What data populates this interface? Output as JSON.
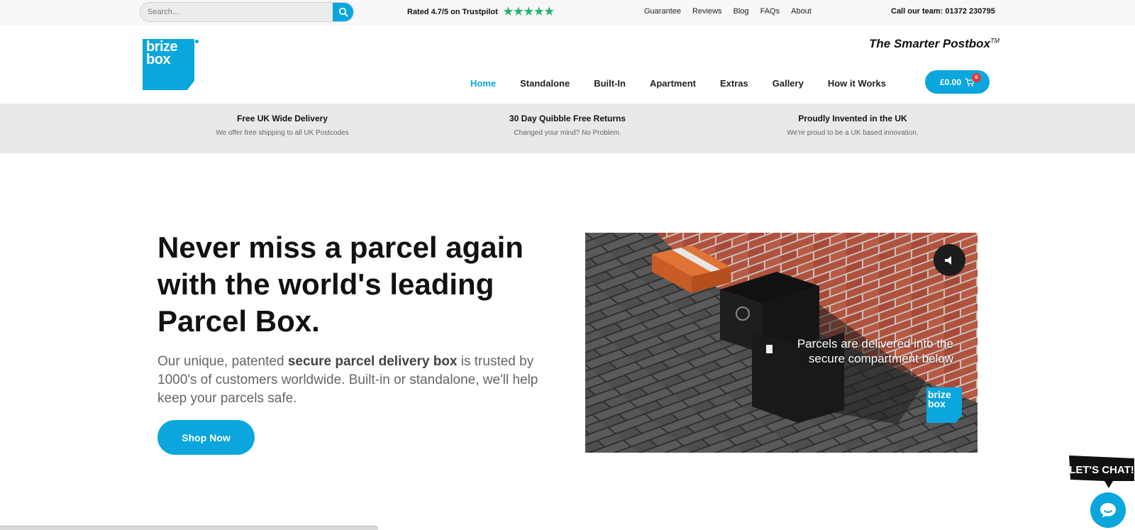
{
  "topbar": {
    "search_placeholder": "Search...",
    "trustpilot_text": "Rated 4.7/5 on Trustpilot",
    "trustpilot_rating": 4.7,
    "links": [
      "Guarantee",
      "Reviews",
      "Blog",
      "FAQs",
      "About"
    ],
    "call_text": "Call our team: 01372 230795"
  },
  "header": {
    "logo_line1": "brize",
    "logo_line2": "box",
    "tagline": "The Smarter Postbox",
    "tagline_mark": "TM",
    "nav": [
      {
        "label": "Home",
        "active": true
      },
      {
        "label": "Standalone",
        "active": false
      },
      {
        "label": "Built-In",
        "active": false
      },
      {
        "label": "Apartment",
        "active": false
      },
      {
        "label": "Extras",
        "active": false
      },
      {
        "label": "Gallery",
        "active": false
      },
      {
        "label": "How it Works",
        "active": false
      }
    ],
    "cart_total": "£0.00",
    "cart_count": "0"
  },
  "benefits": [
    {
      "title": "Free UK Wide Delivery",
      "subtitle": "We offer free shipping to all UK Postcodes"
    },
    {
      "title": "30 Day Quibble Free Returns",
      "subtitle": "Changed your mind? No Problem."
    },
    {
      "title": "Proudly Invented in the UK",
      "subtitle": "We're proud to be a UK based innovation."
    }
  ],
  "hero": {
    "title": "Never miss a parcel again with the world's leading Parcel Box.",
    "sub_before": "Our unique, patented ",
    "sub_bold": "secure parcel delivery box",
    "sub_after": " is trusted by 1000's of customers worldwide. Built-in or standalone, we'll help keep your parcels safe.",
    "cta": "Shop Now"
  },
  "video": {
    "caption_line1": "Parcels are delivered into the",
    "caption_line2": "secure compartment below",
    "logo_line1": "brize",
    "logo_line2": "box"
  },
  "chat": {
    "label": "LET'S CHAT!"
  },
  "colors": {
    "accent": "#0aa6dd",
    "trustpilot_green": "#1fb36b",
    "badge_red": "#e53935"
  }
}
